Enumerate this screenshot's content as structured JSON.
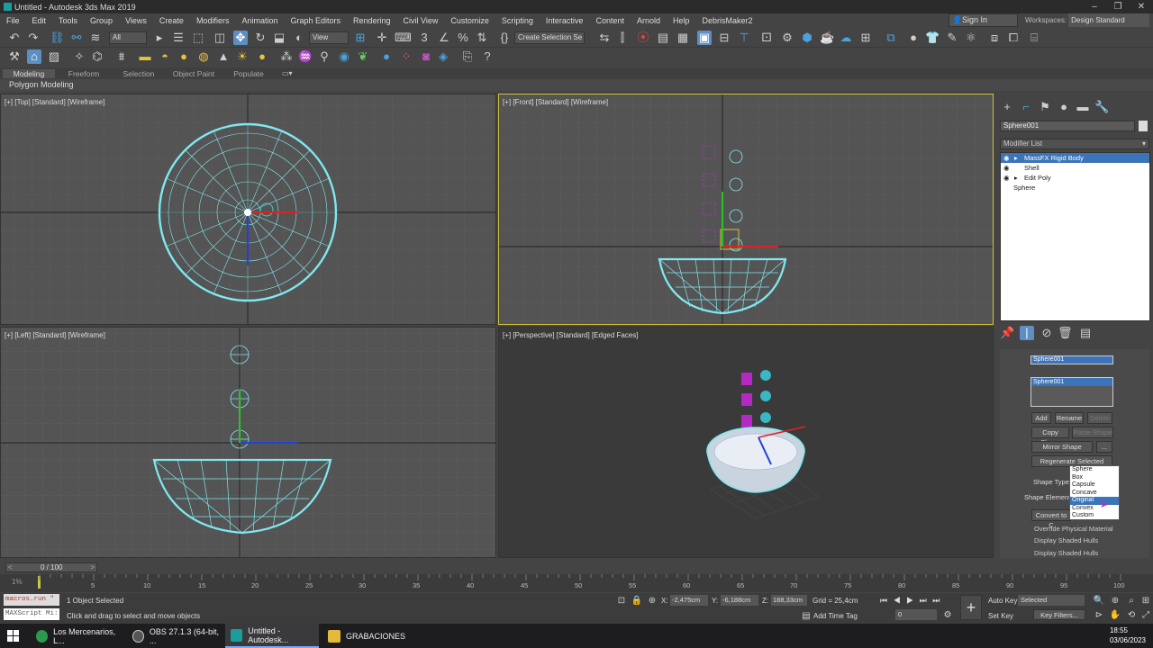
{
  "window": {
    "title": "Untitled - Autodesk 3ds Max 2019",
    "btn_min": "‒",
    "btn_max": "❐",
    "btn_close": "✕"
  },
  "menu": [
    "File",
    "Edit",
    "Tools",
    "Group",
    "Views",
    "Create",
    "Modifiers",
    "Animation",
    "Graph Editors",
    "Rendering",
    "Civil View",
    "Customize",
    "Scripting",
    "Interactive",
    "Content",
    "Arnold",
    "Help",
    "DebrisMaker2"
  ],
  "account": {
    "sign_in": "Sign In",
    "workspaces_label": "Workspaces:",
    "workspace_value": "Design Standard"
  },
  "toolbar": {
    "filter_value": "All",
    "refcoord_value": "View",
    "selection_set": "Create Selection Se"
  },
  "ribbon": {
    "tabs": [
      "Modeling",
      "Freeform",
      "Selection",
      "Object Paint",
      "Populate"
    ],
    "active_panel": "Polygon Modeling"
  },
  "viewports": [
    {
      "label": "[+] [Top] [Standard] [Wireframe]"
    },
    {
      "label": "[+] [Front] [Standard] [Wireframe]"
    },
    {
      "label": "[+] [Left] [Standard] [Wireframe]"
    },
    {
      "label": "[+] [Perspective] [Standard] [Edged Faces]"
    }
  ],
  "command_panel": {
    "object_name": "Sphere001",
    "modifier_list": "Modifier List",
    "stack": [
      "MassFX Rigid Body",
      "Shell",
      "Edit Poly",
      "Sphere"
    ],
    "rollout": {
      "shape_name": "Sphere001",
      "shape_list_item": "Sphere001",
      "add": "Add",
      "rename": "Rename",
      "delete": "Delete",
      "copy_shape": "Copy Shape",
      "paste_shape": "Paste Shape",
      "mirror_shape": "Mirror Shape",
      "more": "...",
      "regenerate": "Regenerate Selected",
      "shape_type_label": "Shape Type:",
      "shape_element_label": "Shape Element:",
      "convert_to": "Convert to C",
      "shape_type_options": [
        "Sphere",
        "Box",
        "Capsule",
        "Concave",
        "Original",
        "Convex",
        "Custom"
      ],
      "shape_type_highlight": "Original",
      "checks": [
        "Override Physical Material",
        "Display Shaded Hulls",
        "Display Shaded Hulls"
      ]
    }
  },
  "timeline": {
    "frame_display": "0 / 100",
    "ticks": [
      "5",
      "10",
      "15",
      "20",
      "25",
      "30",
      "35",
      "40",
      "45",
      "50",
      "55",
      "60",
      "65",
      "70",
      "75",
      "80",
      "85",
      "90",
      "95",
      "100"
    ],
    "start_tick": "1%"
  },
  "status": {
    "maxscript_top": "macros.run \"",
    "maxscript_bottom": "MAXScript Mi:",
    "selected": "1 Object Selected",
    "prompt": "Click and drag to select and move objects",
    "x_label": "X:",
    "x_value": "-2,475cm",
    "y_label": "Y:",
    "y_value": "-6,188cm",
    "z_label": "Z:",
    "z_value": "188,33cm",
    "grid": "Grid = 25,4cm",
    "add_time_tag": "Add Time Tag",
    "auto_key": "Auto Key",
    "set_key": "Set Key",
    "selected_dd": "Selected",
    "key_filters": "Key Filters...",
    "frame_value": "0"
  },
  "taskbar": {
    "items": [
      "Los Mercenarios, L...",
      "OBS 27.1.3 (64-bit, ...",
      "Untitled - Autodesk...",
      "GRABACIONES"
    ],
    "time": "18:55",
    "date": "03/06/2023"
  },
  "colors": {
    "accent": "#5d8fc2",
    "wire": "#7fe8f0",
    "active_border": "#d0c33a",
    "highlight_row": "#3b74b8"
  }
}
